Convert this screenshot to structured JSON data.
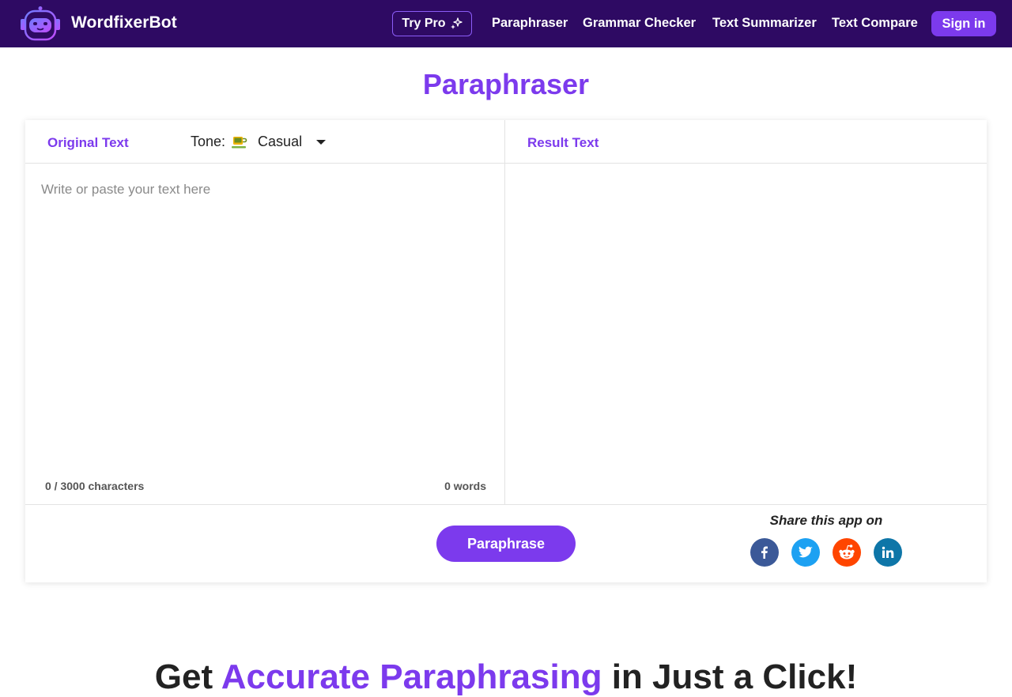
{
  "header": {
    "brand": "WordfixerBot",
    "try_pro": "Try Pro",
    "nav": [
      "Paraphraser",
      "Grammar Checker",
      "Text Summarizer",
      "Text Compare"
    ],
    "sign_in": "Sign in"
  },
  "page_title": "Paraphraser",
  "editor": {
    "original_label": "Original Text",
    "tone_label": "Tone:",
    "tone_value": "Casual",
    "tone_icon": "coffee-cup-icon",
    "placeholder": "Write or paste your text here",
    "char_count": "0 / 3000 characters",
    "word_count": "0 words",
    "result_label": "Result Text"
  },
  "footer": {
    "paraphrase_button": "Paraphrase",
    "share_label": "Share this app on",
    "share_icons": [
      "facebook-icon",
      "twitter-icon",
      "reddit-icon",
      "linkedin-icon"
    ]
  },
  "teaser": {
    "prefix": "Get",
    "accent": "Accurate Paraphrasing",
    "suffix": "in Just a Click!"
  },
  "colors": {
    "nav_bg": "#2e0a63",
    "accent": "#7c3aed",
    "facebook": "#3b5998",
    "twitter": "#1da1f2",
    "reddit": "#ff4500",
    "linkedin": "#0e76a8"
  }
}
